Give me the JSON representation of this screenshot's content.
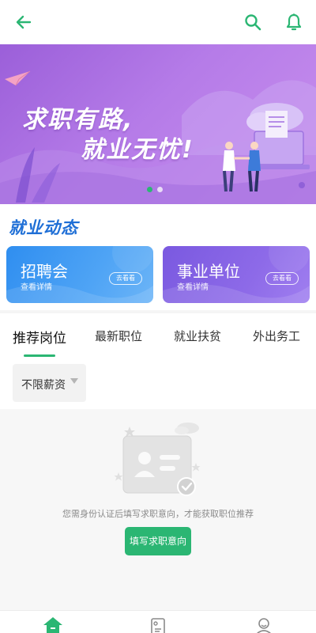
{
  "header": {
    "back_icon": "arrow-left-icon",
    "search_icon": "search-icon",
    "bell_icon": "bell-icon",
    "accent_color": "#2bb673"
  },
  "banner": {
    "line1": "求职有路,",
    "line2": "就业无忧!",
    "slide_count": 2,
    "active_slide": 1
  },
  "section": {
    "title": "就业动态"
  },
  "cards": [
    {
      "title": "招聘会",
      "subtitle": "查看详情",
      "button": "去看看",
      "color": "#3d96f2"
    },
    {
      "title": "事业单位",
      "subtitle": "查看详情",
      "button": "去看看",
      "color": "#8563e6"
    }
  ],
  "tabs": [
    {
      "label": "推荐岗位",
      "active": true
    },
    {
      "label": "最新职位",
      "active": false
    },
    {
      "label": "就业扶贫",
      "active": false
    },
    {
      "label": "外出务工",
      "active": false
    }
  ],
  "filter": {
    "salary_label": "不限薪资"
  },
  "empty_state": {
    "message": "您需身份认证后填写求职意向，才能获取职位推荐",
    "button_label": "填写求职意向"
  },
  "bottom_nav": {
    "items": [
      {
        "icon": "home-icon",
        "active": true
      },
      {
        "icon": "resume-icon",
        "active": false
      },
      {
        "icon": "profile-icon",
        "active": false
      }
    ]
  }
}
